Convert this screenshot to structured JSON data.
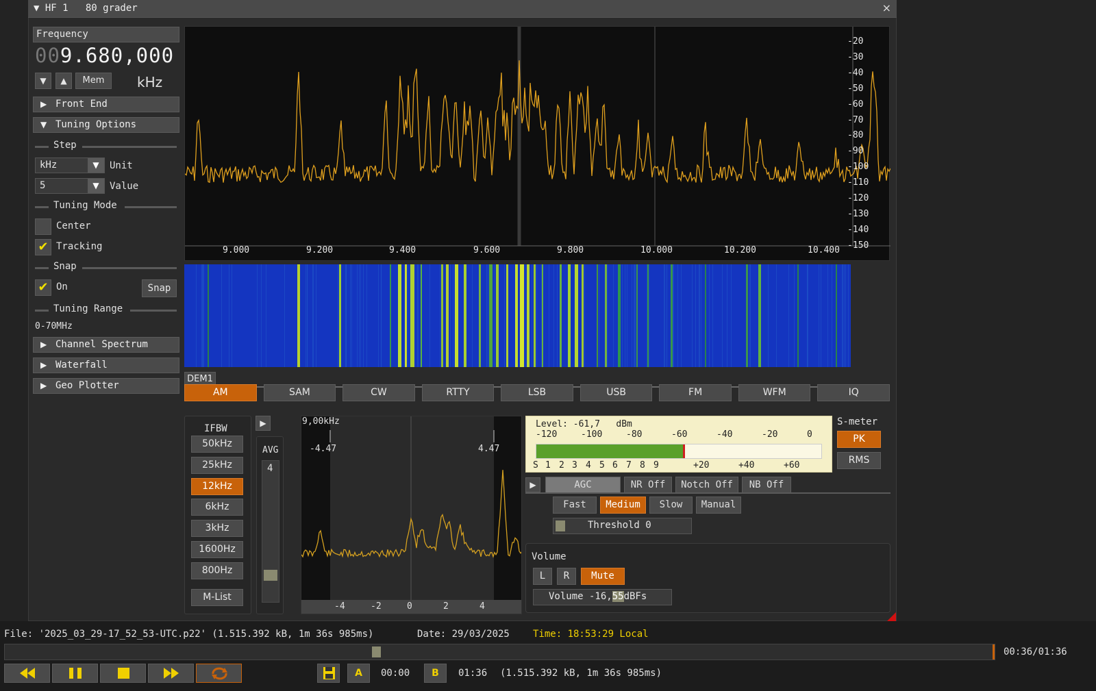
{
  "window": {
    "title": "▼ HF 1   80 grader",
    "close": "×"
  },
  "frequency": {
    "header": "Frequency",
    "leading": "00",
    "value": "9.680,000",
    "unit": "kHz",
    "down": "▼",
    "up": "▲",
    "mem": "Mem"
  },
  "panels": {
    "front_end": "Front End",
    "tuning_options": "Tuning Options",
    "channel_spectrum": "Channel Spectrum",
    "waterfall": "Waterfall",
    "geo_plotter": "Geo Plotter"
  },
  "tuning": {
    "step_label": "Step",
    "unit_value": "kHz",
    "unit_label": "Unit",
    "step_value": "5",
    "value_label": "Value",
    "mode_label": "Tuning Mode",
    "center_label": "Center",
    "center_checked": false,
    "tracking_label": "Tracking",
    "tracking_checked": true,
    "snap_label": "Snap",
    "snap_on_label": "On",
    "snap_on_checked": true,
    "snap_button": "Snap",
    "range_label": "Tuning Range",
    "range_value": "0-70MHz"
  },
  "spectrum": {
    "y_ticks": [
      "-20",
      "-30",
      "-40",
      "-50",
      "-60",
      "-70",
      "-80",
      "-90",
      "-100",
      "-110",
      "-120",
      "-130",
      "-140",
      "-150"
    ],
    "x_ticks": [
      "9.000",
      "9.200",
      "9.400",
      "9.600",
      "9.800",
      "10.000",
      "10.200",
      "10.400"
    ],
    "trace_color": "#e0a01e"
  },
  "demod": {
    "tab": "DEM1",
    "modes": [
      {
        "label": "AM",
        "active": true
      },
      {
        "label": "SAM",
        "active": false
      },
      {
        "label": "CW",
        "active": false
      },
      {
        "label": "RTTY",
        "active": false
      },
      {
        "label": "LSB",
        "active": false
      },
      {
        "label": "USB",
        "active": false
      },
      {
        "label": "FM",
        "active": false
      },
      {
        "label": "WFM",
        "active": false
      },
      {
        "label": "IQ",
        "active": false
      }
    ],
    "accent": "#c8620a"
  },
  "ifbw": {
    "title": "IFBW",
    "buttons": [
      {
        "label": "50kHz",
        "active": false
      },
      {
        "label": "25kHz",
        "active": false
      },
      {
        "label": "12kHz",
        "active": true
      },
      {
        "label": "6kHz",
        "active": false
      },
      {
        "label": "3kHz",
        "active": false
      },
      {
        "label": "1600Hz",
        "active": false
      },
      {
        "label": "800Hz",
        "active": false
      }
    ],
    "mlist": "M-List",
    "play": "▶"
  },
  "avg": {
    "label": "AVG",
    "value": "4"
  },
  "channel": {
    "span": "9,00kHz",
    "left_marker": "-4.47",
    "right_marker": "4.47",
    "x_ticks": [
      "-4",
      "-2",
      "0",
      "2",
      "4"
    ]
  },
  "smeter": {
    "level_text": "Level: -61,7   dBm",
    "dbm_ticks": [
      "-120",
      "-100",
      "-80",
      "-60",
      "-40",
      "-20",
      "0"
    ],
    "s_ticks": [
      "S",
      "1",
      "2",
      "3",
      "4",
      "5",
      "6",
      "7",
      "8",
      "9",
      "+20",
      "+40",
      "+60"
    ],
    "level_dbm": -61.7,
    "title": "S-meter",
    "pk": "PK",
    "rms": "RMS",
    "bar_color": "#5aa02a"
  },
  "agc": {
    "play": "▶",
    "agc": "AGC",
    "nr": "NR Off",
    "notch": "Notch Off",
    "nb": "NB Off",
    "speeds": [
      {
        "label": "Fast",
        "active": false
      },
      {
        "label": "Medium",
        "active": true
      },
      {
        "label": "Slow",
        "active": false
      },
      {
        "label": "Manual",
        "active": false
      }
    ],
    "threshold": "Threshold 0"
  },
  "volume": {
    "title": "Volume",
    "l": "L",
    "r": "R",
    "mute": "Mute",
    "slider_prefix": "Volume -16,",
    "slider_highlight": "55",
    "slider_suffix": "dBFs"
  },
  "statusbar": {
    "file": "File: '2025_03_29-17_52_53-UTC.p22' (1.515.392 kB, 1m 36s 985ms)",
    "date": "Date: 29/03/2025",
    "time": "Time: 18:53:29 Local",
    "progress_text": "00:36/01:36",
    "progress_fraction": 0.375,
    "a_label": "A",
    "a_time": "00:00",
    "b_label": "B",
    "b_time": "01:36",
    "b_info": "(1.515.392 kB, 1m 36s 985ms)"
  }
}
